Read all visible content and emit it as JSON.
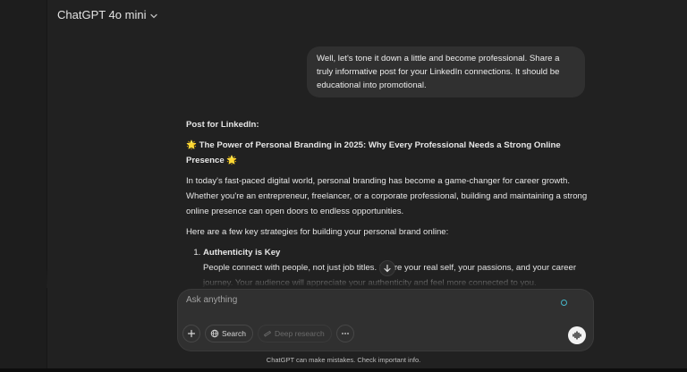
{
  "header": {
    "model_label": "ChatGPT 4o mini"
  },
  "conversation": {
    "user_message": "Well, let's tone it down a little and become professional. Share a truly informative post for your LinkedIn connections. It should be educational into promotional.",
    "assistant": {
      "heading": "Post for LinkedIn:",
      "title_star": "🌟",
      "title": "The Power of Personal Branding in 2025: Why Every Professional Needs a Strong Online Presence",
      "intro": "In today's fast-paced digital world, personal branding has become a game-changer for career growth. Whether you're an entrepreneur, freelancer, or a corporate professional, building and maintaining a strong online presence can open doors to endless opportunities.",
      "lead_in": "Here are a few key strategies for building your personal brand online:",
      "list": [
        {
          "title": "Authenticity is Key",
          "body": "People connect with people, not just job titles. Share your real self, your passions, and your career journey. Your audience will appreciate your authenticity and feel more connected to you."
        }
      ]
    }
  },
  "composer": {
    "placeholder": "Ask anything",
    "search_label": "Search",
    "deep_research_label": "Deep research"
  },
  "footer": {
    "note": "ChatGPT can make mistakes. Check important info."
  },
  "colors": {
    "background": "#212121",
    "bubble": "#303030",
    "star": "#f5c518",
    "accent_dot": "#46b6c8"
  }
}
